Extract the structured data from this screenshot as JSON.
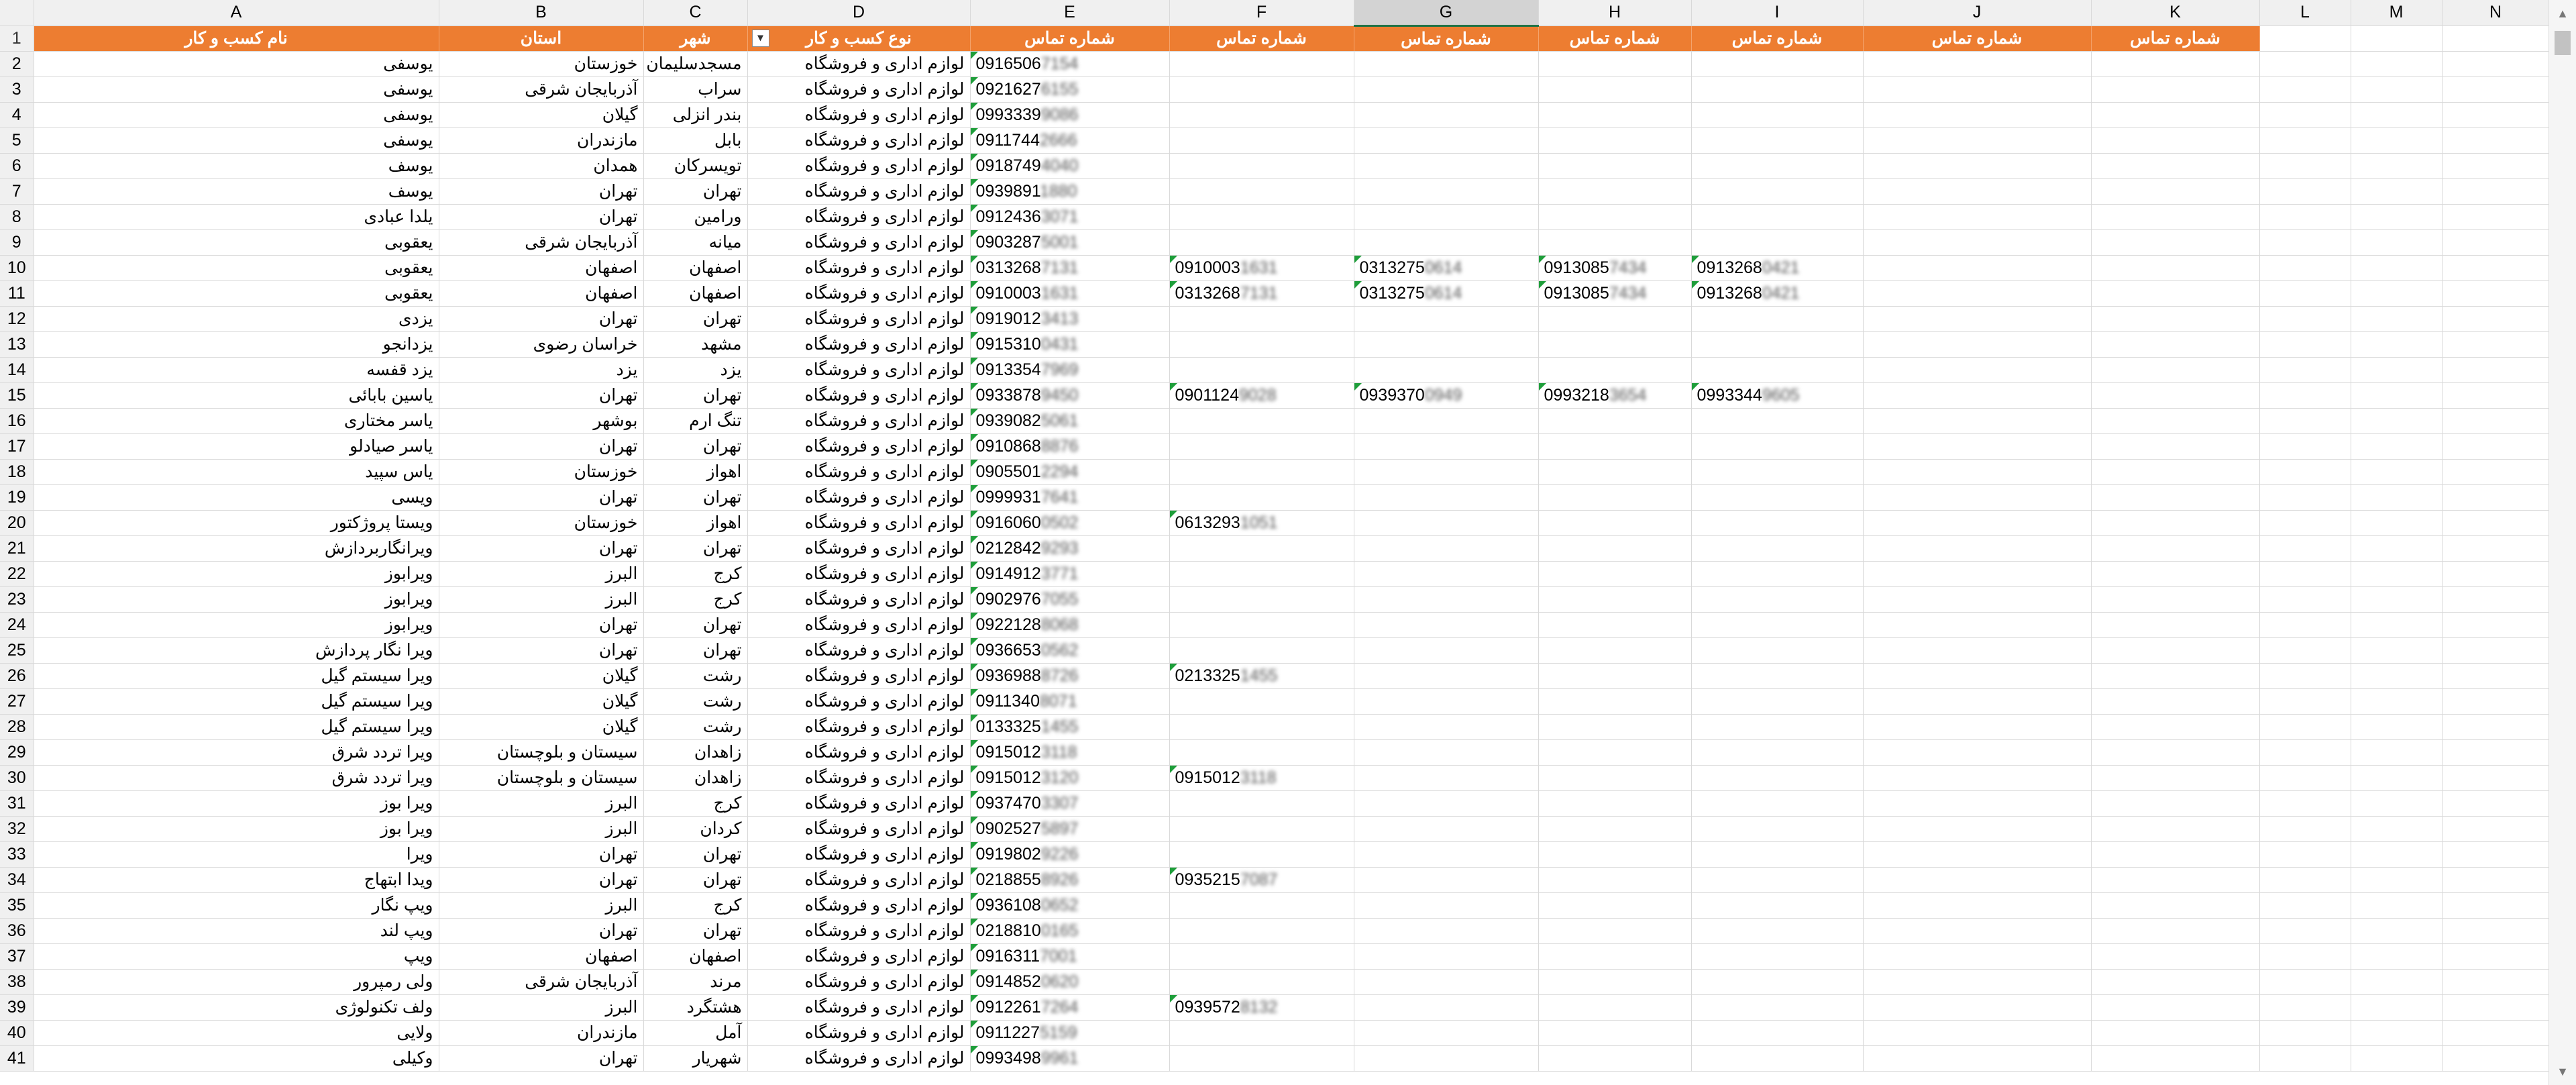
{
  "columns": [
    "A",
    "B",
    "C",
    "D",
    "E",
    "F",
    "G",
    "H",
    "I",
    "J",
    "K",
    "L",
    "M",
    "N"
  ],
  "selected_column": "G",
  "header_row": {
    "row": "1",
    "cells": [
      "نام کسب و کار",
      "استان",
      "شهر",
      "نوع کسب و کار",
      "شماره تماس",
      "شماره تماس",
      "شماره تماس",
      "شماره تماس",
      "شماره تماس",
      "شماره تماس",
      "شماره تماس"
    ],
    "filter_icon": "filter-active-icon"
  },
  "rows": [
    {
      "n": "2",
      "a": "یوسفی",
      "b": "خوزستان",
      "c": "مسجدسلیمان",
      "d": "لوازم اداری و فروشگاه",
      "e": "0916506",
      "eb": "7154"
    },
    {
      "n": "3",
      "a": "یوسفی",
      "b": "آذربایجان شرقی",
      "c": "سراب",
      "d": "لوازم اداری و فروشگاه",
      "e": "0921627",
      "eb": "6155"
    },
    {
      "n": "4",
      "a": "یوسفی",
      "b": "گیلان",
      "c": "بندر انزلی",
      "d": "لوازم اداری و فروشگاه",
      "e": "0993339",
      "eb": "9086"
    },
    {
      "n": "5",
      "a": "یوسفی",
      "b": "مازندران",
      "c": "بابل",
      "d": "لوازم اداری و فروشگاه",
      "e": "0911744",
      "eb": "2666"
    },
    {
      "n": "6",
      "a": "یوسف",
      "b": "همدان",
      "c": "تویسرکان",
      "d": "لوازم اداری و فروشگاه",
      "e": "0918749",
      "eb": "4040"
    },
    {
      "n": "7",
      "a": "یوسف",
      "b": "تهران",
      "c": "تهران",
      "d": "لوازم اداری و فروشگاه",
      "e": "0939891",
      "eb": "1880"
    },
    {
      "n": "8",
      "a": "یلدا عبادی",
      "b": "تهران",
      "c": "ورامین",
      "d": "لوازم اداری و فروشگاه",
      "e": "0912436",
      "eb": "3071"
    },
    {
      "n": "9",
      "a": "یعقوبی",
      "b": "آذربایجان شرقی",
      "c": "میانه",
      "d": "لوازم اداری و فروشگاه",
      "e": "0903287",
      "eb": "5001"
    },
    {
      "n": "10",
      "a": "یعقوبی",
      "b": "اصفهان",
      "c": "اصفهان",
      "d": "لوازم اداری و فروشگاه",
      "e": "0313268",
      "eb": "7131",
      "f": "0910003",
      "fb": "1631",
      "g": "0313275",
      "gb": "0614",
      "h": "0913085",
      "hb": "7434",
      "i": "0913268",
      "ib": "0421"
    },
    {
      "n": "11",
      "a": "یعقوبی",
      "b": "اصفهان",
      "c": "اصفهان",
      "d": "لوازم اداری و فروشگاه",
      "e": "0910003",
      "eb": "1631",
      "f": "0313268",
      "fb": "7131",
      "g": "0313275",
      "gb": "0614",
      "h": "0913085",
      "hb": "7434",
      "i": "0913268",
      "ib": "0421"
    },
    {
      "n": "12",
      "a": "یزدی",
      "b": "تهران",
      "c": "تهران",
      "d": "لوازم اداری و فروشگاه",
      "e": "0919012",
      "eb": "3413"
    },
    {
      "n": "13",
      "a": "یزدانجو",
      "b": "خراسان رضوی",
      "c": "مشهد",
      "d": "لوازم اداری و فروشگاه",
      "e": "0915310",
      "eb": "0431"
    },
    {
      "n": "14",
      "a": "یزد قفسه",
      "b": "یزد",
      "c": "یزد",
      "d": "لوازم اداری و فروشگاه",
      "e": "0913354",
      "eb": "7969"
    },
    {
      "n": "15",
      "a": "یاسین بابائی",
      "b": "تهران",
      "c": "تهران",
      "d": "لوازم اداری و فروشگاه",
      "e": "0933878",
      "eb": "9450",
      "f": "0901124",
      "fb": "9028",
      "g": "0939370",
      "gb": "0949",
      "h": "0993218",
      "hb": "3654",
      "i": "0993344",
      "ib": "9605"
    },
    {
      "n": "16",
      "a": "یاسر مختاری",
      "b": "بوشهر",
      "c": "تنگ ارم",
      "d": "لوازم اداری و فروشگاه",
      "e": "0939082",
      "eb": "5061"
    },
    {
      "n": "17",
      "a": "یاسر صیادلو",
      "b": "تهران",
      "c": "تهران",
      "d": "لوازم اداری و فروشگاه",
      "e": "0910868",
      "eb": "8876"
    },
    {
      "n": "18",
      "a": "یاس سپید",
      "b": "خوزستان",
      "c": "اهواز",
      "d": "لوازم اداری و فروشگاه",
      "e": "0905501",
      "eb": "2294"
    },
    {
      "n": "19",
      "a": "ویسی",
      "b": "تهران",
      "c": "تهران",
      "d": "لوازم اداری و فروشگاه",
      "e": "0999931",
      "eb": "7641"
    },
    {
      "n": "20",
      "a": "ویستا پروژکتور",
      "b": "خوزستان",
      "c": "اهواز",
      "d": "لوازم اداری و فروشگاه",
      "e": "0916060",
      "eb": "0502",
      "f": "0613293",
      "fb": "1051"
    },
    {
      "n": "21",
      "a": "ویرانگاربردازش",
      "b": "تهران",
      "c": "تهران",
      "d": "لوازم اداری و فروشگاه",
      "e": "0212842",
      "eb": "9293"
    },
    {
      "n": "22",
      "a": "ویرابوز",
      "b": "البرز",
      "c": "کرج",
      "d": "لوازم اداری و فروشگاه",
      "e": "0914912",
      "eb": "3771"
    },
    {
      "n": "23",
      "a": "ویرابوز",
      "b": "البرز",
      "c": "کرج",
      "d": "لوازم اداری و فروشگاه",
      "e": "0902976",
      "eb": "7055"
    },
    {
      "n": "24",
      "a": "ویرابوز",
      "b": "تهران",
      "c": "تهران",
      "d": "لوازم اداری و فروشگاه",
      "e": "0922128",
      "eb": "8068"
    },
    {
      "n": "25",
      "a": "ویرا نگار پردازش",
      "b": "تهران",
      "c": "تهران",
      "d": "لوازم اداری و فروشگاه",
      "e": "0936653",
      "eb": "0562"
    },
    {
      "n": "26",
      "a": "ویرا سیستم گیل",
      "b": "گیلان",
      "c": "رشت",
      "d": "لوازم اداری و فروشگاه",
      "e": "0936988",
      "eb": "8726",
      "f": "0213325",
      "fb": "1455"
    },
    {
      "n": "27",
      "a": "ویرا سیستم گیل",
      "b": "گیلان",
      "c": "رشت",
      "d": "لوازم اداری و فروشگاه",
      "e": "0911340",
      "eb": "8071"
    },
    {
      "n": "28",
      "a": "ویرا سیستم گیل",
      "b": "گیلان",
      "c": "رشت",
      "d": "لوازم اداری و فروشگاه",
      "e": "0133325",
      "eb": "1455"
    },
    {
      "n": "29",
      "a": "ویرا تردد شرق",
      "b": "سیستان و بلوچستان",
      "c": "زاهدان",
      "d": "لوازم اداری و فروشگاه",
      "e": "0915012",
      "eb": "3118"
    },
    {
      "n": "30",
      "a": "ویرا تردد شرق",
      "b": "سیستان و بلوچستان",
      "c": "زاهدان",
      "d": "لوازم اداری و فروشگاه",
      "e": "0915012",
      "eb": "3120",
      "f": "0915012",
      "fb": "3118"
    },
    {
      "n": "31",
      "a": "ویرا بوز",
      "b": "البرز",
      "c": "کرج",
      "d": "لوازم اداری و فروشگاه",
      "e": "0937470",
      "eb": "3307"
    },
    {
      "n": "32",
      "a": "ویرا بوز",
      "b": "البرز",
      "c": "کردان",
      "d": "لوازم اداری و فروشگاه",
      "e": "0902527",
      "eb": "5897"
    },
    {
      "n": "33",
      "a": "ویرا",
      "b": "تهران",
      "c": "تهران",
      "d": "لوازم اداری و فروشگاه",
      "e": "0919802",
      "eb": "9226"
    },
    {
      "n": "34",
      "a": "ویدا ابتهاج",
      "b": "تهران",
      "c": "تهران",
      "d": "لوازم اداری و فروشگاه",
      "e": "0218855",
      "eb": "8926",
      "f": "0935215",
      "fb": "7087"
    },
    {
      "n": "35",
      "a": "ویپ نگار",
      "b": "البرز",
      "c": "کرج",
      "d": "لوازم اداری و فروشگاه",
      "e": "0936108",
      "eb": "0652"
    },
    {
      "n": "36",
      "a": "ویپ لند",
      "b": "تهران",
      "c": "تهران",
      "d": "لوازم اداری و فروشگاه",
      "e": "0218810",
      "eb": "0165"
    },
    {
      "n": "37",
      "a": "ویپ",
      "b": "اصفهان",
      "c": "اصفهان",
      "d": "لوازم اداری و فروشگاه",
      "e": "0916311",
      "eb": "7001"
    },
    {
      "n": "38",
      "a": "ولی رمپرور",
      "b": "آذربایجان شرقی",
      "c": "مرند",
      "d": "لوازم اداری و فروشگاه",
      "e": "0914852",
      "eb": "0620"
    },
    {
      "n": "39",
      "a": "ولف تکنولوژی",
      "b": "البرز",
      "c": "هشتگرد",
      "d": "لوازم اداری و فروشگاه",
      "e": "0912261",
      "eb": "7264",
      "f": "0939572",
      "fb": "8132"
    },
    {
      "n": "40",
      "a": "ولایی",
      "b": "مازندران",
      "c": "آمل",
      "d": "لوازم اداری و فروشگاه",
      "e": "0911227",
      "eb": "5159"
    },
    {
      "n": "41",
      "a": "وکیلی",
      "b": "تهران",
      "c": "شهریار",
      "d": "لوازم اداری و فروشگاه",
      "e": "0993498",
      "eb": "9961"
    }
  ]
}
